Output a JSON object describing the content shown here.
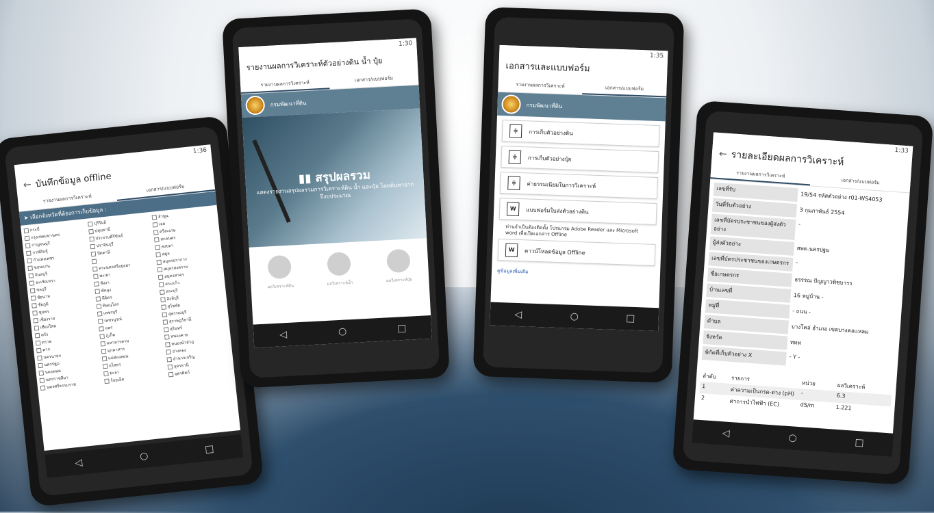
{
  "phone1": {
    "status_time": "1:36",
    "title": "บันทึกข้อมูล offline",
    "tabs": [
      "รายงานผลการวิเคราะห์",
      "เอกสาร/แบบฟอร์ม"
    ],
    "province_header": "เลือกจังหวัดที่ต้องการเก็บข้อมูล :",
    "provinces": [
      "กระบี่",
      "บุรีรัมย์",
      "ลำพูน",
      "กรุงเทพมหานคร",
      "ปทุมธานี",
      "เลย",
      "กาญจนบุรี",
      "ประจวบคีรีขันธ์",
      "ศรีสะเกษ",
      "กาฬสินธุ์",
      "ปราจีนบุรี",
      "สกลนคร",
      "กำแพงเพชร",
      "ปัตตานี",
      "สงขลา",
      "ขอนแก่น",
      "",
      "สตูล",
      "จันทบุรี",
      "พระนครศรีอยุธยา",
      "สมุทรปราการ",
      "ฉะเชิงเทรา",
      "พะเยา",
      "สมุทรสงคราม",
      "ชลบุรี",
      "พังงา",
      "สมุทรสาคร",
      "ชัยนาท",
      "พัทลุง",
      "สระแก้ว",
      "ชัยภูมิ",
      "พิจิตร",
      "สระบุรี",
      "ชุมพร",
      "พิษณุโลก",
      "สิงห์บุรี",
      "เชียงราย",
      "เพชรบุรี",
      "สุโขทัย",
      "เชียงใหม่",
      "เพชรบูรณ์",
      "สุพรรณบุรี",
      "ตรัง",
      "แพร่",
      "สุราษฎร์ธานี",
      "ตราด",
      "ภูเก็ต",
      "สุรินทร์",
      "ตาก",
      "มหาสารคาม",
      "หนองคาย",
      "นครนายก",
      "มุกดาหาร",
      "หนองบัวลำภู",
      "นครปฐม",
      "แม่ฮ่องสอน",
      "อ่างทอง",
      "นครพนม",
      "ยโสธร",
      "อำนาจเจริญ",
      "นครราชสีมา",
      "ยะลา",
      "อุดรธานี",
      "นครศรีธรรมราช",
      "ร้อยเอ็ด",
      "อุตรดิตถ์"
    ]
  },
  "phone2": {
    "status_time": "1:30",
    "title": "รายงานผลการวิเคราะห์ตัวอย่างดิน น้ำ ปุ๋ย",
    "tabs": [
      "รายงานผลการวิเคราะห์",
      "เอกสาร/แบบฟอร์ม"
    ],
    "org": "กรมพัฒนาที่ดิน",
    "hero_title": "สรุปผลรวม",
    "hero_sub": "แสดงรายงานสรุปผลรวมการวิเคราะห์ดิน น้ำ และปุ๋ย โดยค้นหาจากปีงบประมาณ",
    "icons": [
      "ผลวิเคราะห์ดิน",
      "ผลวิเคราะห์น้ำ",
      "ผลวิเคราะห์ปุ๋ย"
    ]
  },
  "phone3": {
    "status_time": "1:35",
    "title": "เอกสารและแบบฟอร์ม",
    "tabs": [
      "รายงานผลการวิเคราะห์",
      "เอกสาร/แบบฟอร์ม"
    ],
    "org": "กรมพัฒนาที่ดิน",
    "docs": [
      {
        "icon": "pdf",
        "label": "การเก็บตัวอย่างดิน"
      },
      {
        "icon": "pdf",
        "label": "การเก็บตัวอย่างปุ๋ย"
      },
      {
        "icon": "pdf",
        "label": "ค่าธรรมเนียมในการวิเคราะห์"
      },
      {
        "icon": "word",
        "label": "แบบฟอร์มใบส่งตัวอย่างดิน"
      }
    ],
    "note": "ท่านจำเป็นต้องติดตั้ง โปรแกรม Adobe Reader และ Microsoft word เพื่อเปิดเอกสาร Offline",
    "download": "ดาวน์โหลดข้อมูล Offline",
    "more": "ดูข้อมูลเพิ่มเติม"
  },
  "phone4": {
    "status_time": "1:33",
    "title": "รายละเอียดผลการวิเคราะห์",
    "tabs": [
      "รายงานผลการวิเคราะห์",
      "เอกสาร/แบบฟอร์ม"
    ],
    "rows": [
      {
        "label": "เลขที่รับ",
        "value": "19/54   รหัสตัวอย่าง  r01-WS4053"
      },
      {
        "label": "วันที่รับตัวอย่าง",
        "value": "3 กุมภาพันธ์ 2554"
      },
      {
        "label": "เลขที่บัตรประชาชนของผู้ส่งตัวอย่าง",
        "value": "-"
      },
      {
        "label": "ผู้ส่งตัวอย่าง",
        "value": "สพด.นครปฐม"
      },
      {
        "label": "เลขที่บัตรประชาชนของเกษตรกร",
        "value": "-"
      },
      {
        "label": "ชื่อเกษตรกร",
        "value": "ธรรรณ ปัญญาวพิชบารร"
      },
      {
        "label": "บ้านเลขที่",
        "value": "16   หมู่บ้าน  -"
      },
      {
        "label": "หมู่ที่",
        "value": "-    ถนน  -"
      },
      {
        "label": "ตำบล",
        "value": "บางโคล่   อำเภอ  เขตบางคอแหลม"
      },
      {
        "label": "จังหวัด",
        "value": "ททท"
      },
      {
        "label": "พิกัดที่เก็บตัวอย่าง X",
        "value": "-    Y   -"
      }
    ],
    "result_headers": [
      "ลำดับ",
      "รายการ",
      "หน่วย",
      "ผลวิเคราะห์"
    ],
    "results": [
      {
        "no": "1",
        "item": "ค่าความเป็นกรด-ด่าง (pH)",
        "unit": "-",
        "value": "6.3"
      },
      {
        "no": "2",
        "item": "ค่าการนำไฟฟ้า (EC)",
        "unit": "dS/m",
        "value": "1.221"
      }
    ]
  }
}
